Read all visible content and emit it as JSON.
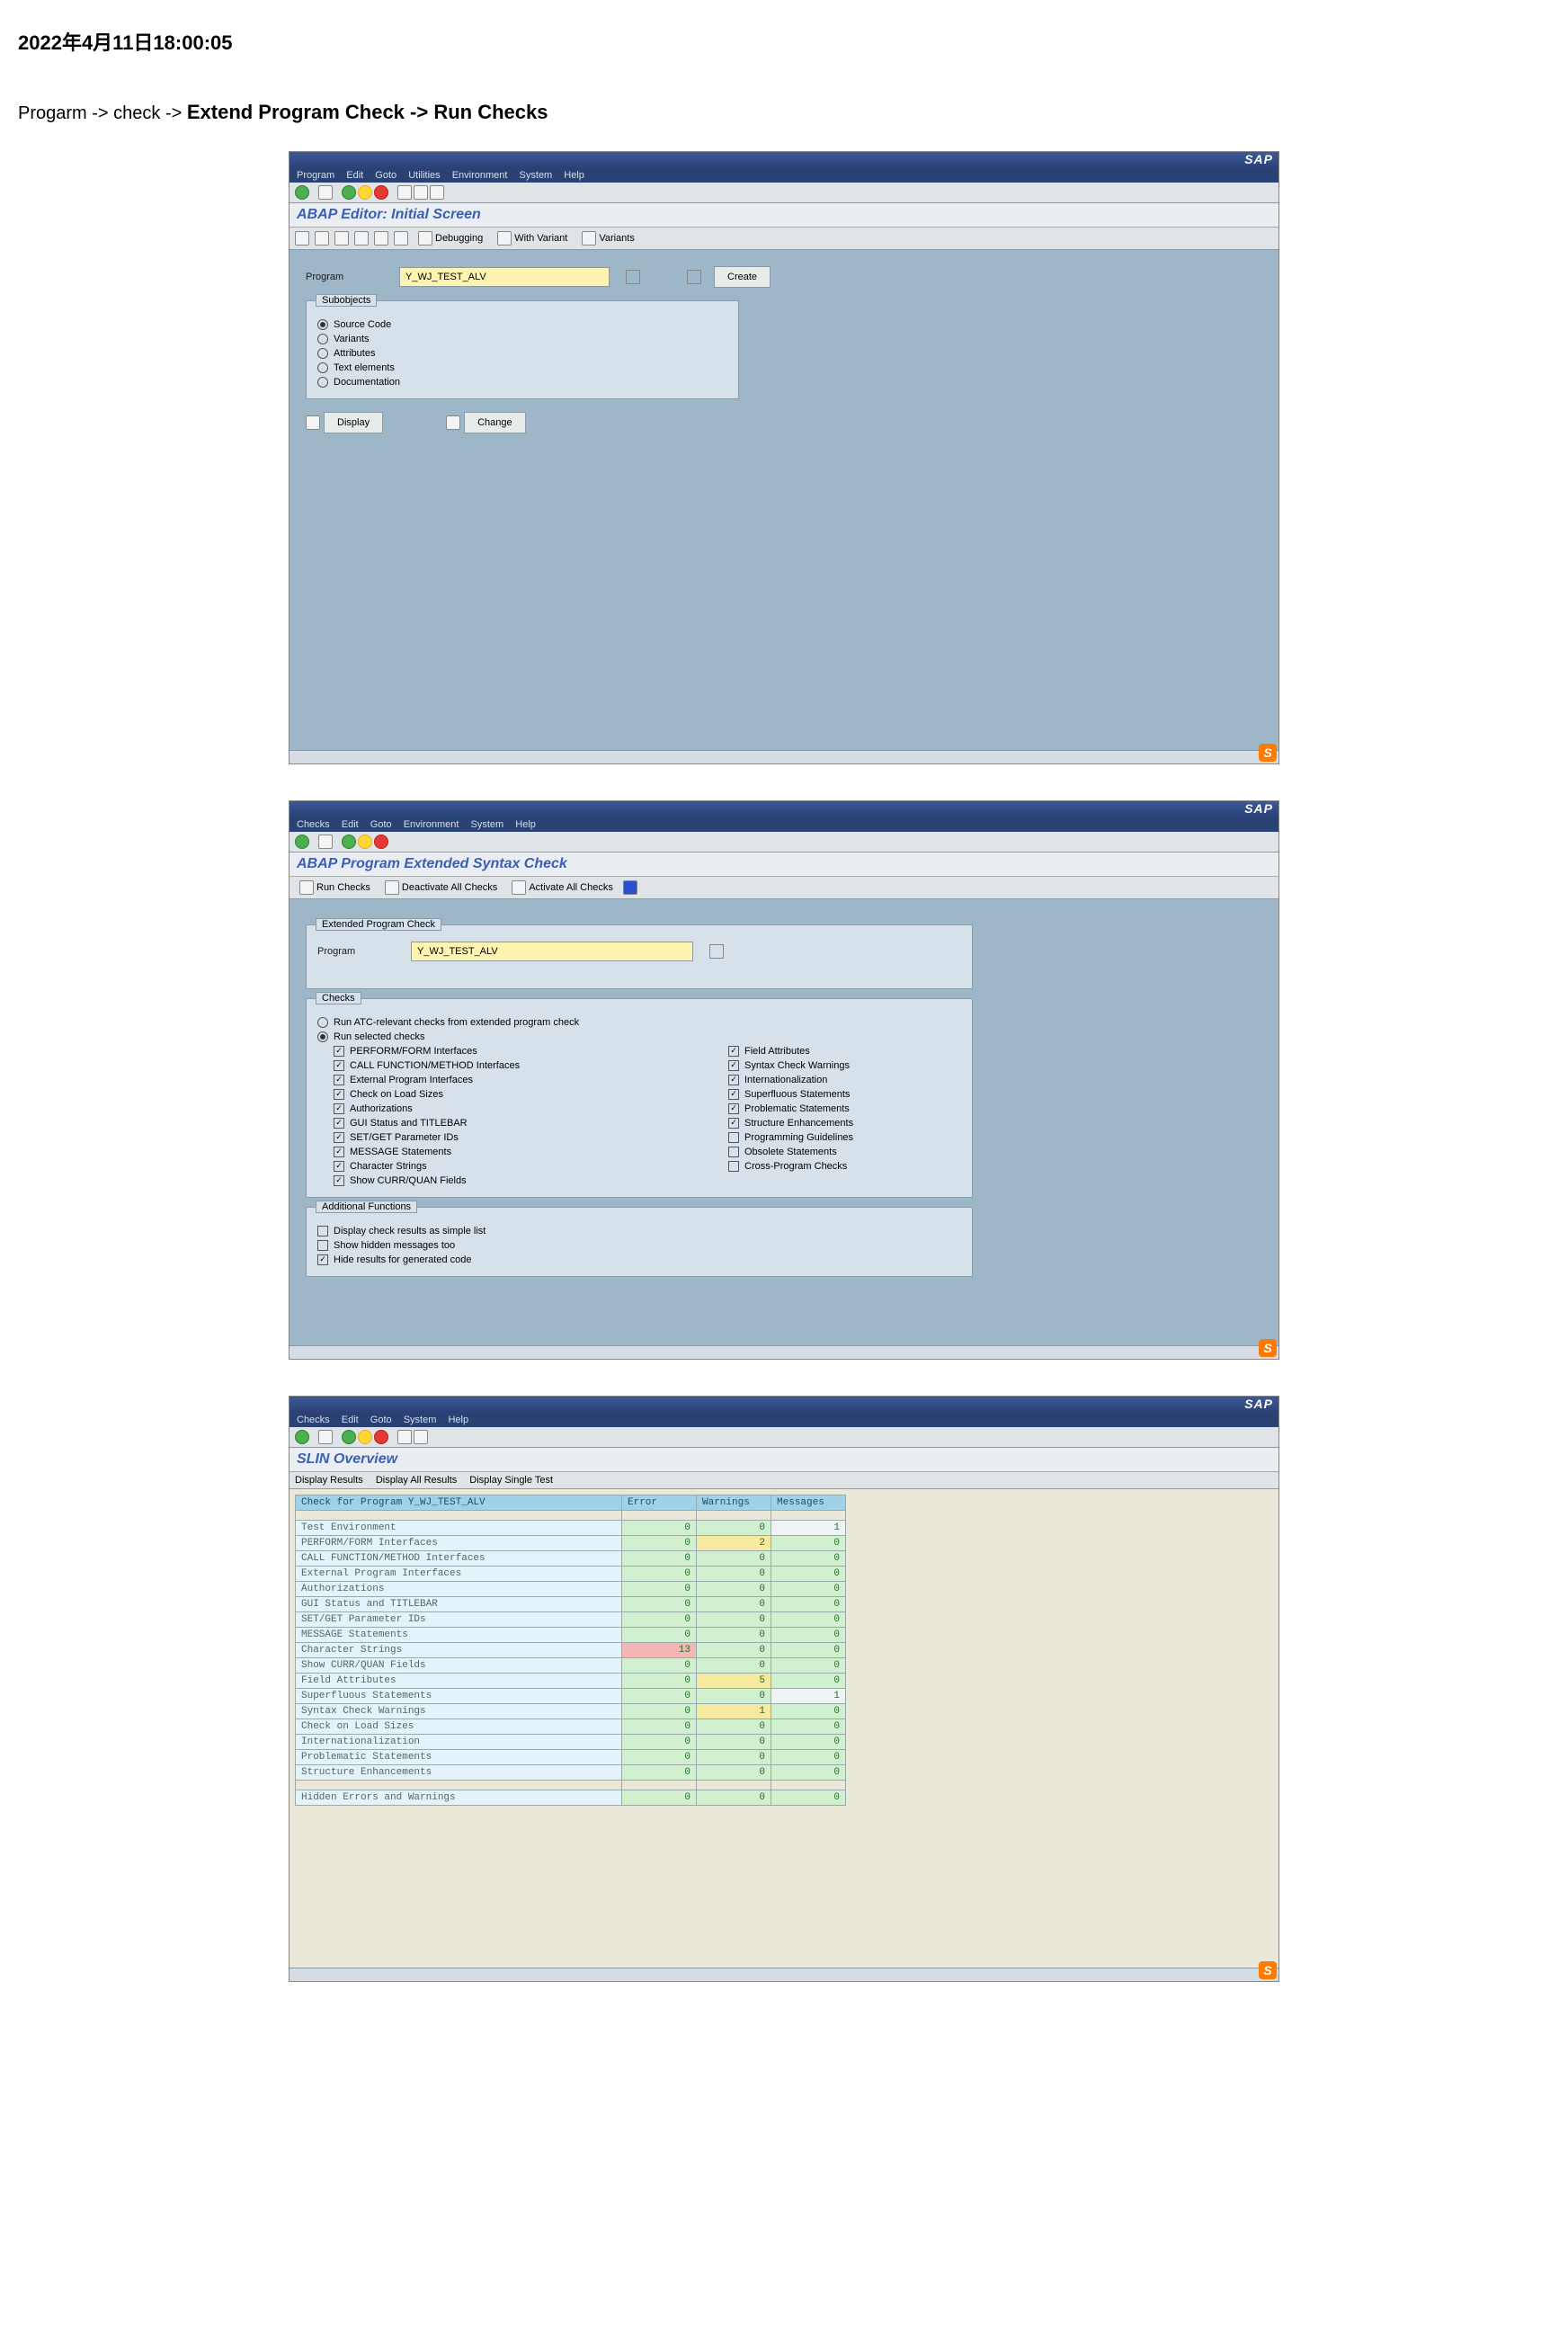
{
  "page": {
    "date_header": "2022年4月11日18:00:05",
    "path_prefix": "Progarm -> check -> ",
    "path_bold": "Extend Program Check -> Run Checks"
  },
  "shot1": {
    "menu": [
      "Program",
      "Edit",
      "Goto",
      "Utilities",
      "Environment",
      "System",
      "Help"
    ],
    "title": "ABAP Editor: Initial Screen",
    "apptb": [
      "Debugging",
      "With Variant",
      "Variants"
    ],
    "program_label": "Program",
    "program_value": "Y_WJ_TEST_ALV",
    "create_btn": "Create",
    "subobjects_title": "Subobjects",
    "subobjects": [
      {
        "label": "Source Code",
        "sel": true
      },
      {
        "label": "Variants",
        "sel": false
      },
      {
        "label": "Attributes",
        "sel": false
      },
      {
        "label": "Text elements",
        "sel": false
      },
      {
        "label": "Documentation",
        "sel": false
      }
    ],
    "display_btn": "Display",
    "change_btn": "Change"
  },
  "shot2": {
    "menu": [
      "Checks",
      "Edit",
      "Goto",
      "Environment",
      "System",
      "Help"
    ],
    "title": "ABAP Program Extended Syntax Check",
    "apptb": [
      "Run Checks",
      "Deactivate All Checks",
      "Activate All Checks"
    ],
    "epc_title": "Extended Program Check",
    "program_label": "Program",
    "program_value": "Y_WJ_TEST_ALV",
    "checks_title": "Checks",
    "atc_radio": "Run ATC-relevant checks from extended program check",
    "selected_radio": "Run selected checks",
    "left_checks": [
      {
        "label": "PERFORM/FORM Interfaces",
        "sel": true
      },
      {
        "label": "CALL FUNCTION/METHOD Interfaces",
        "sel": true
      },
      {
        "label": "External Program Interfaces",
        "sel": true
      },
      {
        "label": "Check on Load Sizes",
        "sel": true
      },
      {
        "label": "Authorizations",
        "sel": true
      },
      {
        "label": "GUI Status and TITLEBAR",
        "sel": true
      },
      {
        "label": "SET/GET Parameter IDs",
        "sel": true
      },
      {
        "label": "MESSAGE Statements",
        "sel": true
      },
      {
        "label": "Character Strings",
        "sel": true
      },
      {
        "label": "Show CURR/QUAN Fields",
        "sel": true
      }
    ],
    "right_checks": [
      {
        "label": "Field Attributes",
        "sel": true
      },
      {
        "label": "Syntax Check Warnings",
        "sel": true
      },
      {
        "label": "Internationalization",
        "sel": true
      },
      {
        "label": "Superfluous Statements",
        "sel": true
      },
      {
        "label": "Problematic Statements",
        "sel": true
      },
      {
        "label": "Structure Enhancements",
        "sel": true
      },
      {
        "label": "Programming Guidelines",
        "sel": false
      },
      {
        "label": "Obsolete Statements",
        "sel": false
      },
      {
        "label": "Cross-Program Checks",
        "sel": false
      }
    ],
    "addl_title": "Additional Functions",
    "addl": [
      {
        "label": "Display check results as simple list",
        "sel": false
      },
      {
        "label": "Show hidden messages too",
        "sel": false
      },
      {
        "label": "Hide results for generated code",
        "sel": true
      }
    ]
  },
  "shot3": {
    "menu": [
      "Checks",
      "Edit",
      "Goto",
      "System",
      "Help"
    ],
    "title": "SLIN Overview",
    "apptb": [
      "Display Results",
      "Display All Results",
      "Display Single Test"
    ],
    "th_name": "Check for Program Y_WJ_TEST_ALV",
    "th_err": "Error",
    "th_warn": "Warnings",
    "th_msg": "Messages",
    "rows": [
      {
        "name": "Test Environment",
        "e": "0",
        "w": "0",
        "m": "1",
        "mcls": "msg"
      },
      {
        "name": "PERFORM/FORM Interfaces",
        "e": "0",
        "w": "2",
        "m": "0",
        "wcls": "hl-yellow"
      },
      {
        "name": "CALL FUNCTION/METHOD Interfaces",
        "e": "0",
        "w": "0",
        "m": "0"
      },
      {
        "name": "External Program Interfaces",
        "e": "0",
        "w": "0",
        "m": "0"
      },
      {
        "name": "Authorizations",
        "e": "0",
        "w": "0",
        "m": "0"
      },
      {
        "name": "GUI Status and TITLEBAR",
        "e": "0",
        "w": "0",
        "m": "0"
      },
      {
        "name": "SET/GET Parameter IDs",
        "e": "0",
        "w": "0",
        "m": "0"
      },
      {
        "name": "MESSAGE Statements",
        "e": "0",
        "w": "0",
        "m": "0"
      },
      {
        "name": "Character Strings",
        "e": "13",
        "w": "0",
        "m": "0",
        "ecls": "hl-red"
      },
      {
        "name": "Show CURR/QUAN Fields",
        "e": "0",
        "w": "0",
        "m": "0"
      },
      {
        "name": "Field Attributes",
        "e": "0",
        "w": "5",
        "m": "0",
        "wcls": "hl-yellow"
      },
      {
        "name": "Superfluous Statements",
        "e": "0",
        "w": "0",
        "m": "1",
        "mcls": "msg"
      },
      {
        "name": "Syntax Check Warnings",
        "e": "0",
        "w": "1",
        "m": "0",
        "wcls": "hl-yellow"
      },
      {
        "name": "Check on Load Sizes",
        "e": "0",
        "w": "0",
        "m": "0"
      },
      {
        "name": "Internationalization",
        "e": "0",
        "w": "0",
        "m": "0"
      },
      {
        "name": "Problematic Statements",
        "e": "0",
        "w": "0",
        "m": "0"
      },
      {
        "name": "Structure Enhancements",
        "e": "0",
        "w": "0",
        "m": "0"
      }
    ],
    "hidden_row": {
      "name": "Hidden Errors and Warnings",
      "e": "0",
      "w": "0",
      "m": "0"
    }
  }
}
